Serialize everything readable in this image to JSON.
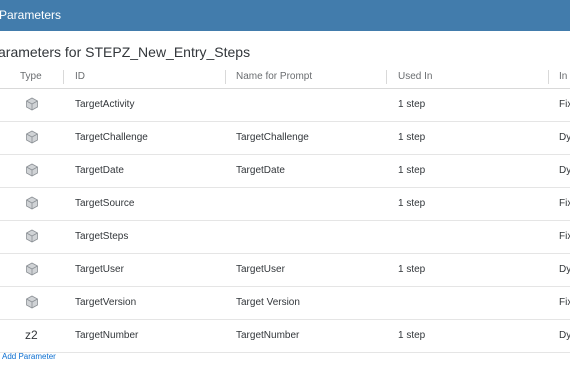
{
  "header": {
    "title": "Parameters"
  },
  "subtitle": "arameters for STEPZ_New_Entry_Steps",
  "columns": {
    "type": "Type",
    "id": "ID",
    "name": "Name for Prompt",
    "used": "Used In",
    "input": "In"
  },
  "rows": [
    {
      "type_icon": "object-cube-icon",
      "id": "TargetActivity",
      "name": "",
      "used": "1 step",
      "input": "Fix"
    },
    {
      "type_icon": "object-cube-icon",
      "id": "TargetChallenge",
      "name": "TargetChallenge",
      "used": "1 step",
      "input": "Dy"
    },
    {
      "type_icon": "object-cube-icon",
      "id": "TargetDate",
      "name": "TargetDate",
      "used": "1 step",
      "input": "Dy"
    },
    {
      "type_icon": "object-cube-icon",
      "id": "TargetSource",
      "name": "",
      "used": "1 step",
      "input": "Fix"
    },
    {
      "type_icon": "object-cube-icon",
      "id": "TargetSteps",
      "name": "",
      "used": "",
      "input": "Fix"
    },
    {
      "type_icon": "object-cube-icon",
      "id": "TargetUser",
      "name": "TargetUser",
      "used": "1 step",
      "input": "Dy"
    },
    {
      "type_icon": "object-cube-icon",
      "id": "TargetVersion",
      "name": "Target Version",
      "used": "",
      "input": "Fix"
    },
    {
      "type_text": "z2",
      "id": "TargetNumber",
      "name": "TargetNumber",
      "used": "1 step",
      "input": "Dy"
    }
  ],
  "add_label": "Add Parameter"
}
